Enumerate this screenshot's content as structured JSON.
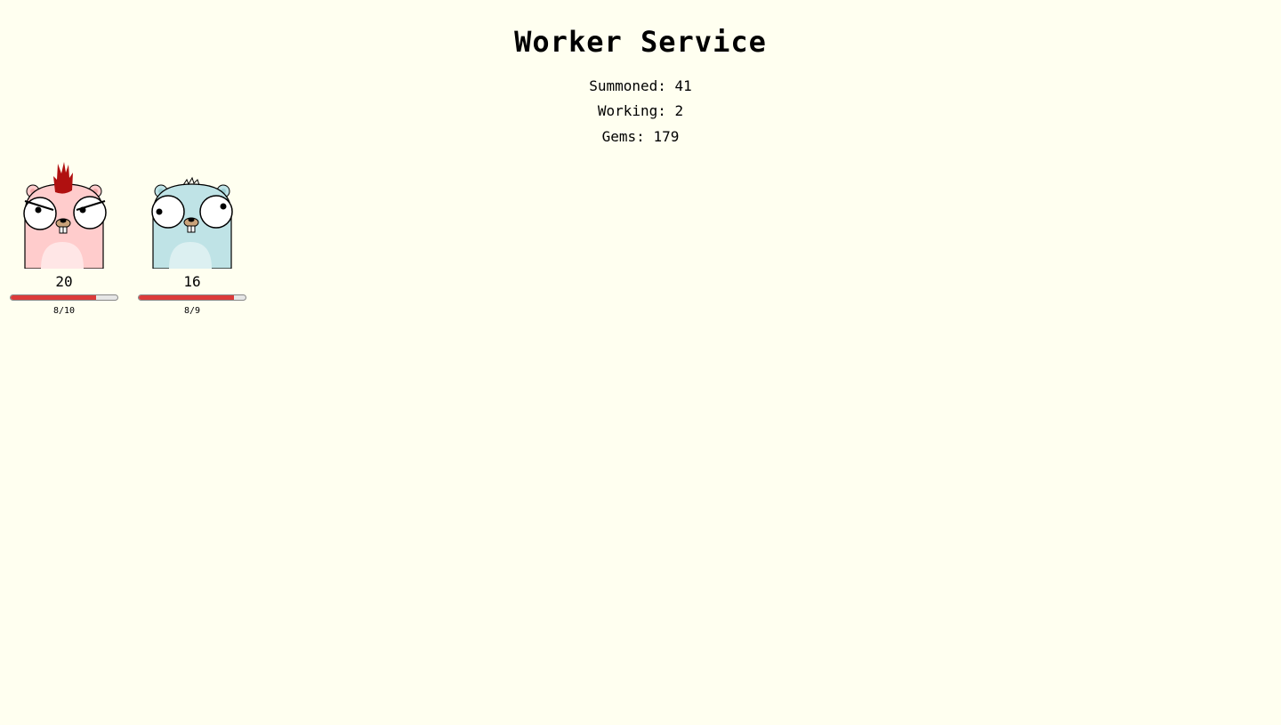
{
  "header": {
    "title": "Worker Service"
  },
  "stats": {
    "summoned": "Summoned: 41",
    "working": "Working: 2",
    "gems": "Gems: 179"
  },
  "colors": {
    "background": "#fffff0",
    "progress_fill": "#dc3a3a",
    "progress_track": "#e6e6e6"
  },
  "workers": [
    {
      "level": "20",
      "progress_text": "8/10",
      "progress_fraction": 0.8,
      "body_color": "#ffcccc",
      "hair": "red-mohawk",
      "icon": "angry-pink-gopher"
    },
    {
      "level": "16",
      "progress_text": "8/9",
      "progress_fraction": 0.889,
      "body_color": "#bfe3e6",
      "hair": "spiky-tuft",
      "icon": "blue-gopher"
    }
  ]
}
